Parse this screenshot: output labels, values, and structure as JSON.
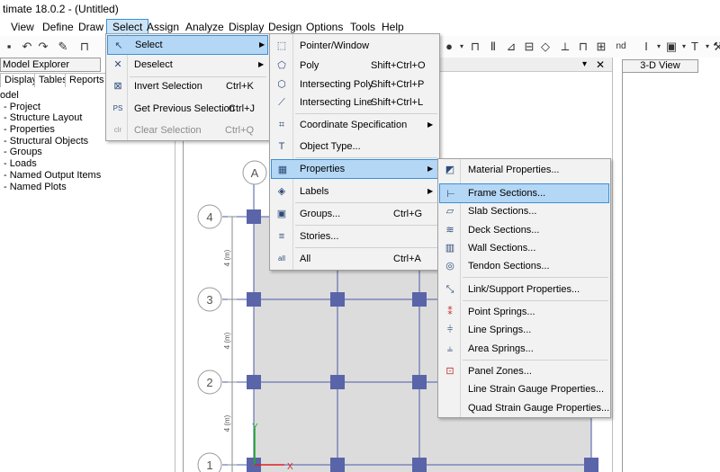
{
  "title_bar": {
    "text": "timate 18.0.2 - (Untitled)"
  },
  "menubar": {
    "items": [
      "View",
      "Define",
      "Draw",
      "Select",
      "Assign",
      "Analyze",
      "Display",
      "Design",
      "Options",
      "Tools",
      "Help"
    ]
  },
  "toolbar": {
    "label_nd": "nd"
  },
  "explorer": {
    "header": "Model Explorer",
    "tabs": [
      "Display",
      "Tables",
      "Reports"
    ],
    "tree": [
      "odel",
      "Project",
      "Structure Layout",
      "Properties",
      "Structural Objects",
      "Groups",
      "Loads",
      "Named Output Items",
      "Named Plots"
    ]
  },
  "view3d": {
    "tab": "3-D View"
  },
  "panel_controls": {
    "dropdown": "▾",
    "close": "✕"
  },
  "plan": {
    "grid_x_labels": [
      "A"
    ],
    "grid_y_labels": [
      "4",
      "3",
      "2",
      "1"
    ],
    "spacing_labels": [
      "4 (m)",
      "4 (m)",
      "4 (m)"
    ],
    "axis_x": "X",
    "axis_y": "Y",
    "colors": {
      "grid": "#4a5aa8",
      "column": "#5a64a8",
      "slab": "#dcdcdc",
      "axis_x": "#e02020",
      "axis_y": "#20b020"
    }
  },
  "select_menu": {
    "items": [
      {
        "label": "Select",
        "shortcut": "",
        "submenu": true,
        "icon": "select-cursor-icon"
      },
      {
        "label": "Deselect",
        "shortcut": "",
        "submenu": true,
        "icon": "deselect-icon"
      },
      {
        "label": "Invert Selection",
        "shortcut": "Ctrl+K",
        "submenu": false,
        "icon": "invert-selection-icon"
      },
      {
        "label": "Get Previous Selection",
        "shortcut": "Ctrl+J",
        "submenu": false,
        "icon": "previous-selection-icon"
      },
      {
        "label": "Clear Selection",
        "shortcut": "Ctrl+Q",
        "submenu": false,
        "icon": "clear-selection-icon"
      }
    ]
  },
  "select_submenu": {
    "items": [
      {
        "label": "Pointer/Window",
        "shortcut": "",
        "submenu": false
      },
      {
        "label": "Poly",
        "shortcut": "Shift+Ctrl+O",
        "submenu": false
      },
      {
        "label": "Intersecting Poly",
        "shortcut": "Shift+Ctrl+P",
        "submenu": false
      },
      {
        "label": "Intersecting Line",
        "shortcut": "Shift+Ctrl+L",
        "submenu": false
      },
      {
        "label": "Coordinate Specification",
        "shortcut": "",
        "submenu": true
      },
      {
        "label": "Object Type...",
        "shortcut": "",
        "submenu": false
      },
      {
        "label": "Properties",
        "shortcut": "",
        "submenu": true
      },
      {
        "label": "Labels",
        "shortcut": "",
        "submenu": true
      },
      {
        "label": "Groups...",
        "shortcut": "Ctrl+G",
        "submenu": false
      },
      {
        "label": "Stories...",
        "shortcut": "",
        "submenu": false
      },
      {
        "label": "All",
        "shortcut": "Ctrl+A",
        "submenu": false
      }
    ]
  },
  "properties_submenu": {
    "items": [
      "Material Properties...",
      "Frame Sections...",
      "Slab Sections...",
      "Deck Sections...",
      "Wall Sections...",
      "Tendon Sections...",
      "Link/Support Properties...",
      "Point Springs...",
      "Line Springs...",
      "Area Springs...",
      "Panel Zones...",
      "Line Strain Gauge Properties...",
      "Quad Strain Gauge Properties..."
    ]
  }
}
